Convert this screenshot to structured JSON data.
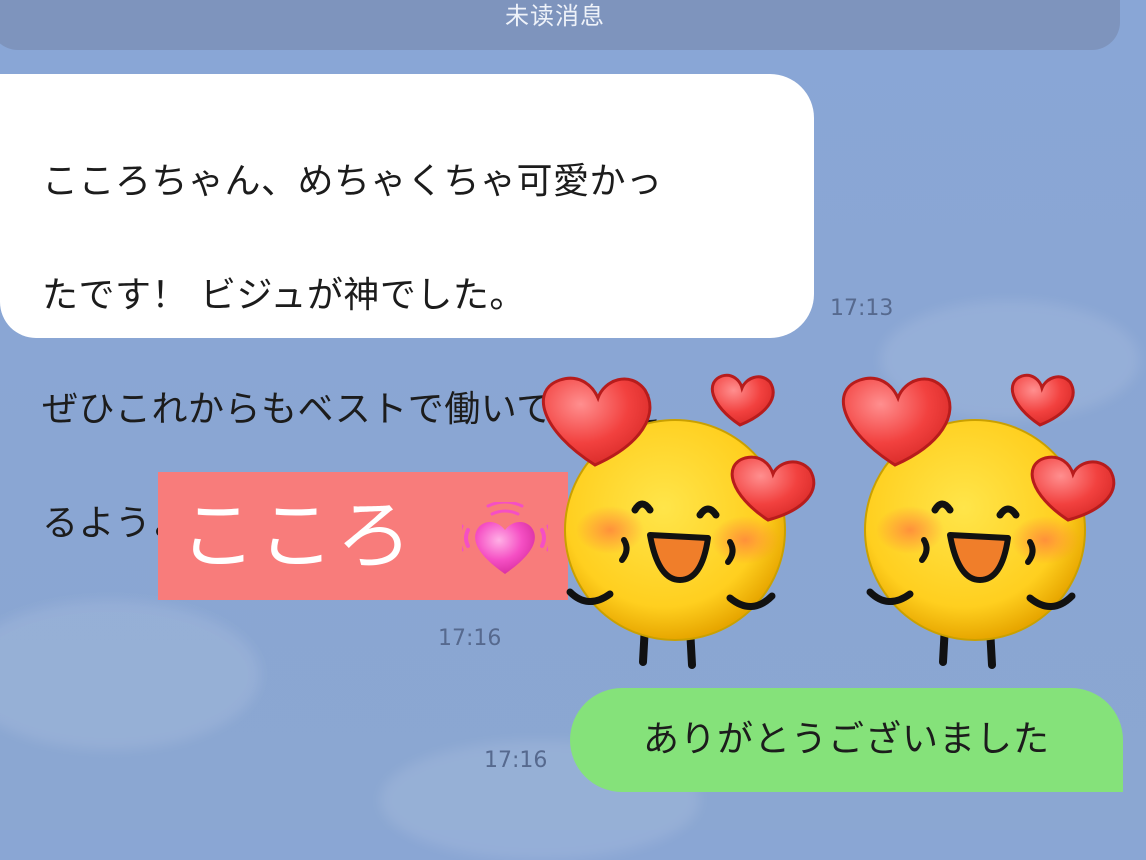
{
  "banner": {
    "label": "未读消息"
  },
  "messages": [
    {
      "direction": "incoming",
      "type": "text",
      "text": "こころちゃん、めちゃくちゃ可愛かったです！ビジュが神でした。\nぜひこれからもベストで働いてもらえるようよろしくお願いします。。。",
      "display_lines": [
        "こころちゃん、めちゃくちゃ可愛かっ",
        "たです！ ビジュが神でした。",
        "ぜひこれからもベストで働いてもらえ",
        "るようよろしくお願いします。。。"
      ],
      "time": "17:13"
    },
    {
      "direction": "outgoing",
      "type": "image",
      "image_text": "こころ",
      "emoji": "beating-heart",
      "time": "17:16"
    },
    {
      "direction": "outgoing",
      "type": "sticker",
      "sticker": "blushing-face-with-hearts",
      "count": 2
    },
    {
      "direction": "outgoing",
      "type": "text",
      "text": "ありがとうございました",
      "time": "17:16"
    }
  ],
  "colors": {
    "chat_background": "#8aa6d4",
    "incoming_bubble": "#ffffff",
    "outgoing_bubble": "#85e27a",
    "name_card": "#f87c7b",
    "banner": "#7e94bd",
    "timestamp": "#56698e"
  }
}
